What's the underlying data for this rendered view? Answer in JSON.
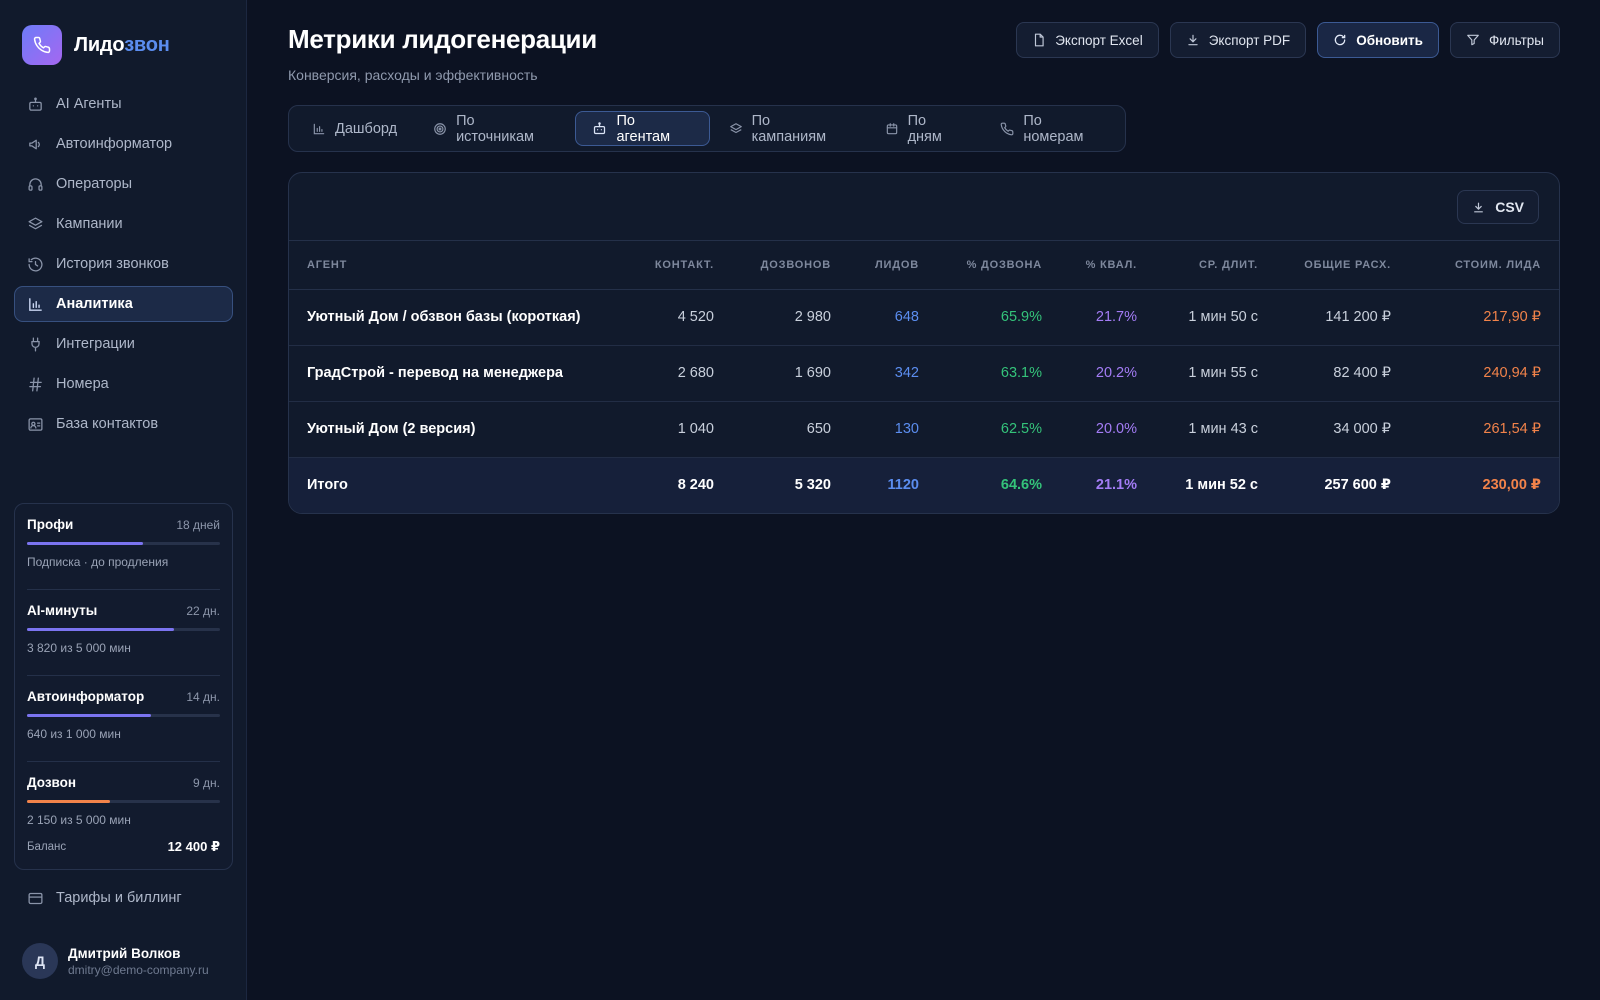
{
  "brand": {
    "name_part1": "Лидо",
    "name_part2": "звон"
  },
  "sidebar": {
    "items": [
      {
        "label": "AI Агенты",
        "icon": "robot-icon"
      },
      {
        "label": "Автоинформатор",
        "icon": "megaphone-icon"
      },
      {
        "label": "Операторы",
        "icon": "headset-icon"
      },
      {
        "label": "Кампании",
        "icon": "layers-icon"
      },
      {
        "label": "История звонков",
        "icon": "history-icon"
      },
      {
        "label": "Аналитика",
        "icon": "bar-chart-icon",
        "active": true
      },
      {
        "label": "Интеграции",
        "icon": "plug-icon"
      },
      {
        "label": "Номера",
        "icon": "hash-icon"
      },
      {
        "label": "База контактов",
        "icon": "contact-card-icon"
      }
    ],
    "usage": [
      {
        "title": "Профи",
        "days": "18 дней",
        "sub": "Подписка · до продления",
        "progress": 0.6,
        "color": "#7b74f0"
      },
      {
        "title": "AI-минуты",
        "days": "22 дн.",
        "sub": "3 820 из 5 000 мин",
        "progress": 0.764,
        "color": "#7b74f0"
      },
      {
        "title": "Автоинформатор",
        "days": "14 дн.",
        "sub": "640 из 1 000 мин",
        "progress": 0.64,
        "color": "#7b74f0"
      },
      {
        "title": "Дозвон",
        "days": "9 дн.",
        "sub": "2 150 из 5 000 мин",
        "progress": 0.43,
        "color": "#f2834a"
      }
    ],
    "balance_label": "Баланс",
    "balance_value": "12 400 ₽",
    "billing_label": "Тарифы и биллинг",
    "user": {
      "initial": "Д",
      "name": "Дмитрий Волков",
      "email": "dmitry@demo-company.ru"
    }
  },
  "header": {
    "title": "Метрики лидогенерации",
    "subtitle": "Конверсия, расходы и эффективность",
    "actions": {
      "export_excel": "Экспорт Excel",
      "export_pdf": "Экспорт PDF",
      "refresh": "Обновить",
      "filters": "Фильтры"
    }
  },
  "tabs": [
    {
      "label": "Дашборд",
      "icon": "chart-icon"
    },
    {
      "label": "По источникам",
      "icon": "target-icon"
    },
    {
      "label": "По агентам",
      "icon": "robot-icon",
      "active": true
    },
    {
      "label": "По кампаниям",
      "icon": "layers-icon"
    },
    {
      "label": "По дням",
      "icon": "calendar-icon"
    },
    {
      "label": "По номерам",
      "icon": "phone-icon"
    }
  ],
  "table": {
    "csv_label": "CSV",
    "columns": [
      "АГЕНТ",
      "КОНТАКТ.",
      "ДОЗВОНОВ",
      "ЛИДОВ",
      "% ДОЗВОНА",
      "% КВАЛ.",
      "СР. ДЛИТ.",
      "ОБЩИЕ РАСХ.",
      "СТОИМ. ЛИДА"
    ],
    "rows": [
      [
        "Уютный Дом / обзвон базы (короткая)",
        "4 520",
        "2 980",
        "648",
        "65.9%",
        "21.7%",
        "1 мин 50 с",
        "141 200 ₽",
        "217,90 ₽"
      ],
      [
        "ГрадСтрой - перевод на менеджера",
        "2 680",
        "1 690",
        "342",
        "63.1%",
        "20.2%",
        "1 мин 55 с",
        "82 400 ₽",
        "240,94 ₽"
      ],
      [
        "Уютный Дом (2 версия)",
        "1 040",
        "650",
        "130",
        "62.5%",
        "20.0%",
        "1 мин 43 с",
        "34 000 ₽",
        "261,54 ₽"
      ]
    ],
    "total": [
      "Итого",
      "8 240",
      "5 320",
      "1120",
      "64.6%",
      "21.1%",
      "1 мин 52 с",
      "257 600 ₽",
      "230,00 ₽"
    ]
  }
}
